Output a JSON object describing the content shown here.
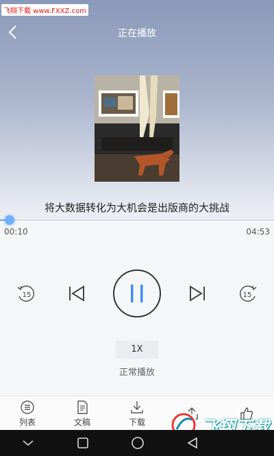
{
  "watermark": "飞翔下载 www.FXXZ.com",
  "header": {
    "title": "正在播放"
  },
  "track": {
    "title": "将大数据转化为大机会是出版商的大挑战"
  },
  "progress": {
    "current": "00:10",
    "total": "04:53",
    "fraction": 0.034
  },
  "controls": {
    "rewind_label": "15",
    "forward_label": "15"
  },
  "speed": {
    "label": "1X",
    "mode": "正常播放"
  },
  "tabs": [
    {
      "label": "列表",
      "icon": "list-icon"
    },
    {
      "label": "文稿",
      "icon": "document-icon"
    },
    {
      "label": "下载",
      "icon": "download-icon"
    },
    {
      "label": "分享",
      "icon": "share-icon"
    },
    {
      "label": "点赞",
      "icon": "thumb-up-icon"
    }
  ],
  "brand": {
    "text": "飞翔下载"
  },
  "colors": {
    "accent": "#5aa3ff",
    "pause": "#3d8ff0"
  }
}
